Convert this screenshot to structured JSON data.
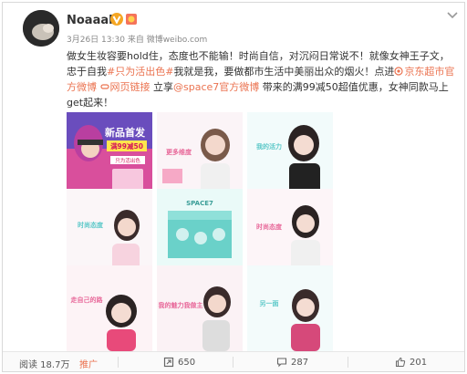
{
  "post": {
    "author": "Noaaah",
    "meta": "3月26日 13:30 来自 微博weibo.com",
    "text_1": "做女生妆容要hold住，态度也不能输！时尚自信，对沉闷日常说不！就像女神王子文，忠于自我",
    "hashtag": "#只为活出色#",
    "text_2": "我就是我，要做都市生活中美丽出众的烟火！点进",
    "link_1": "京东超市官方微博",
    "link_2": "网页链接",
    "text_3": " 立享",
    "mention": "@space7官方微博",
    "text_4": " 带来的满99减50超值优惠，女神同款马上get起来！"
  },
  "images": {
    "cell_1_title": "新品首发",
    "cell_1_sub": "满99减50",
    "cell_1_badge": "只为活出色",
    "cell_2_text": "更多维度",
    "cell_3_text": "我的活力",
    "cell_4_text": "时尚态度",
    "cell_6_text": "时尚态度",
    "cell_7_text": "走自己的路",
    "cell_8_text": "我的魅力我做主",
    "cell_9_text": "另一面",
    "brand": "SPACE7"
  },
  "footer": {
    "reads": "阅读 18.7万",
    "promote": "推广",
    "reposts": "650",
    "comments": "287",
    "likes": "201"
  },
  "colors": {
    "accent": "#eb7350",
    "pink": "#e8699a",
    "teal": "#5bc8c8",
    "verified": "#f5a623"
  },
  "icons": {
    "verified": "verified-v-icon",
    "medal": "medal-icon",
    "chevron": "chevron-down-icon",
    "repost": "repost-icon",
    "comment": "comment-icon",
    "like": "thumbs-up-icon"
  }
}
